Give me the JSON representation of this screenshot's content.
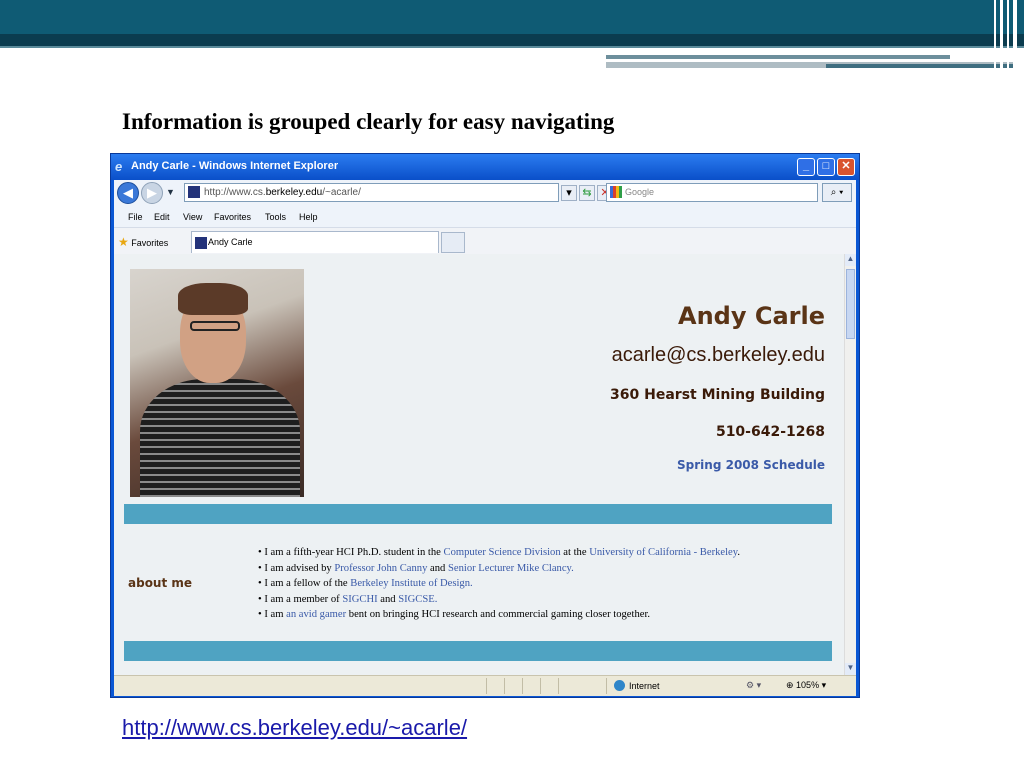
{
  "slide": {
    "title": "Information is grouped clearly for easy navigating",
    "link": "http://www.cs.berkeley.edu/~acarle/"
  },
  "browser": {
    "window_title": "Andy Carle - Windows Internet Explorer",
    "address_prefix": "http://www.cs.",
    "address_host": "berkeley.edu",
    "address_suffix": "/~acarle/",
    "search_placeholder": "Google",
    "menu": [
      "File",
      "Edit",
      "View",
      "Favorites",
      "Tools",
      "Help"
    ],
    "favorites_label": "Favorites",
    "tab_label": "Andy Carle",
    "status_zone": "Internet",
    "zoom": "105%"
  },
  "page": {
    "name": "Andy Carle",
    "email": "acarle@cs.berkeley.edu",
    "building": "360 Hearst Mining Building",
    "phone": "510-642-1268",
    "schedule_link": "Spring 2008 Schedule",
    "about_heading": "about me",
    "bullets": {
      "b1_pre": "I am a fifth-year HCI Ph.D. student in the ",
      "b1_link1": "Computer Science Division",
      "b1_mid": " at the ",
      "b1_link2": "University of California - Berkeley",
      "b1_end": ".",
      "b2_pre": "I am advised by ",
      "b2_link1": "Professor John Canny",
      "b2_mid": " and ",
      "b2_link2": "Senior Lecturer Mike Clancy.",
      "b3_pre": "I am a fellow of the ",
      "b3_link1": "Berkeley Institute of Design.",
      "b4_pre": "I am a member of ",
      "b4_link1": "SIGCHI",
      "b4_mid": " and ",
      "b4_link2": "SIGCSE.",
      "b5_pre": "I am ",
      "b5_link1": "an avid gamer",
      "b5_end": " bent on bringing HCI research and commercial gaming closer together."
    }
  },
  "colors": {
    "slide_bar": "#0f5b74",
    "page_band": "#4fa3c2",
    "name_color": "#5a3416",
    "link_color": "#3a5aa8"
  }
}
